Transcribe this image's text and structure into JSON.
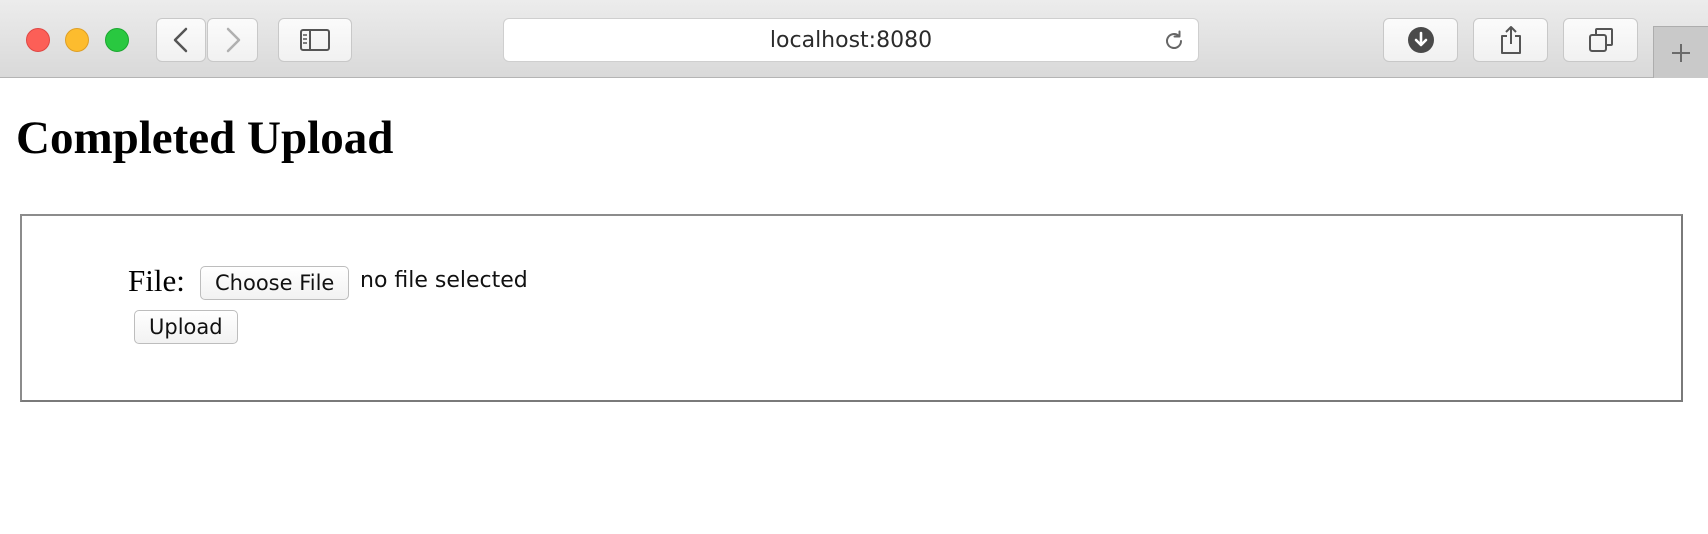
{
  "browser": {
    "url": "localhost:8080",
    "icons": {
      "back": "chevron-left-icon",
      "forward": "chevron-right-icon",
      "sidebar": "sidebar-icon",
      "reload": "reload-icon",
      "download": "download-icon",
      "share": "share-icon",
      "tabs": "tabs-icon",
      "new_tab": "plus-icon"
    },
    "colors": {
      "close": "#fc5f57",
      "minimize": "#fdbc2e",
      "maximize": "#29c840"
    }
  },
  "page": {
    "title": "Completed Upload",
    "form": {
      "file_label": "File:",
      "choose_file_label": "Choose File",
      "file_status": "no file selected",
      "upload_label": "Upload"
    }
  }
}
